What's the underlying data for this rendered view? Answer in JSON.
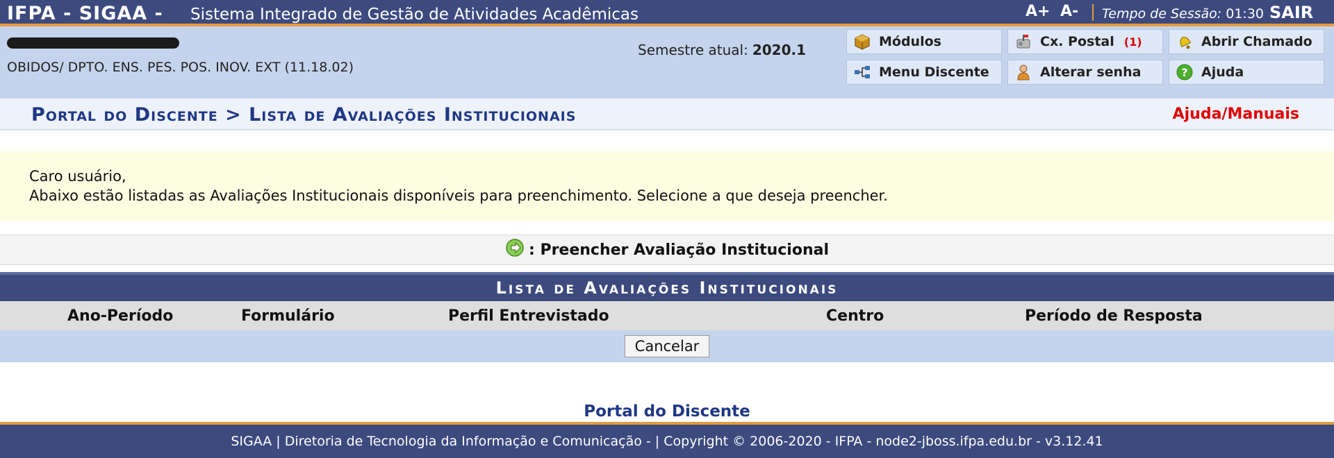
{
  "topbar": {
    "brand": "IFPA - SIGAA -",
    "system_name": "Sistema Integrado de Gestão de Atividades Acadêmicas",
    "font_increase": "A+",
    "font_decrease": "A-",
    "session_label": "Tempo de Sessão:",
    "session_time": "01:30",
    "logout": "SAIR"
  },
  "user": {
    "department": "OBIDOS/ DPTO. ENS. PES. POS. INOV. EXT (11.18.02)",
    "semester_label": "Semestre atual:",
    "semester_value": "2020.1"
  },
  "menu": {
    "modulos": "Módulos",
    "caixa_postal": "Cx. Postal",
    "caixa_postal_count": "(1)",
    "abrir_chamado": "Abrir Chamado",
    "menu_discente": "Menu Discente",
    "alterar_senha": "Alterar senha",
    "ajuda": "Ajuda"
  },
  "breadcrumb": {
    "title": "Portal do Discente > Lista de Avaliações Institucionais",
    "help_link": "Ajuda/Manuais"
  },
  "notice": {
    "line1": "Caro usuário,",
    "line2": "Abaixo estão listadas as Avaliações Institucionais disponíveis para preenchimento. Selecione a que deseja preencher."
  },
  "legend": {
    "text": ": Preencher Avaliação Institucional"
  },
  "table": {
    "caption": "Lista de Avaliações Institucionais",
    "columns": [
      "Ano-Período",
      "Formulário",
      "Perfil Entrevistado",
      "Centro",
      "Período de Resposta"
    ],
    "cancel_label": "Cancelar"
  },
  "footer": {
    "portal_link": "Portal do Discente",
    "text": "SIGAA | Diretoria de Tecnologia da Informação e Comunicação - | Copyright © 2006-2020 - IFPA - node2-jboss.ifpa.edu.br - v3.12.41"
  },
  "colors": {
    "header_bg": "#3c4a7e",
    "accent_orange": "#e59a3c",
    "user_strip": "#c4d4ec",
    "breadcrumb_text": "#1f3784",
    "help_red": "#e00000",
    "notice_bg": "#fdfde2"
  }
}
